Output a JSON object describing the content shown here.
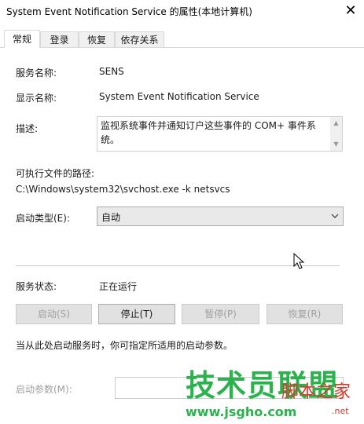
{
  "window": {
    "title": "System Event Notification Service 的属性(本地计算机)",
    "close_glyph": "✕"
  },
  "tabs": [
    {
      "label": "常规",
      "active": true
    },
    {
      "label": "登录",
      "active": false
    },
    {
      "label": "恢复",
      "active": false
    },
    {
      "label": "依存关系",
      "active": false
    }
  ],
  "general": {
    "service_name_label": "服务名称:",
    "service_name_value": "SENS",
    "display_name_label": "显示名称:",
    "display_name_value": "System Event Notification Service",
    "description_label": "描述:",
    "description_value": "监视系统事件并通知订户这些事件的 COM+ 事件系统。",
    "exe_path_label": "可执行文件的路径:",
    "exe_path_value": "C:\\Windows\\system32\\svchost.exe -k netsvcs",
    "startup_type_label": "启动类型(E):",
    "startup_type_value": "自动",
    "status_label": "服务状态:",
    "status_value": "正在运行",
    "buttons": {
      "start": "启动(S)",
      "stop": "停止(T)",
      "pause": "暂停(P)",
      "resume": "恢复(R)"
    },
    "hint_text": "当从此处启动服务时，你可指定所适用的启动参数。",
    "start_params_label": "启动参数(M):",
    "start_params_value": ""
  },
  "watermark": {
    "main": "技术员联盟",
    "side": "脚本之家",
    "url": "www.jsgho.com",
    "net": ".net"
  },
  "colors": {
    "watermark_green": "#2bb24c",
    "watermark_red": "#d33a2c",
    "disabled_text": "#a0a0a0"
  }
}
